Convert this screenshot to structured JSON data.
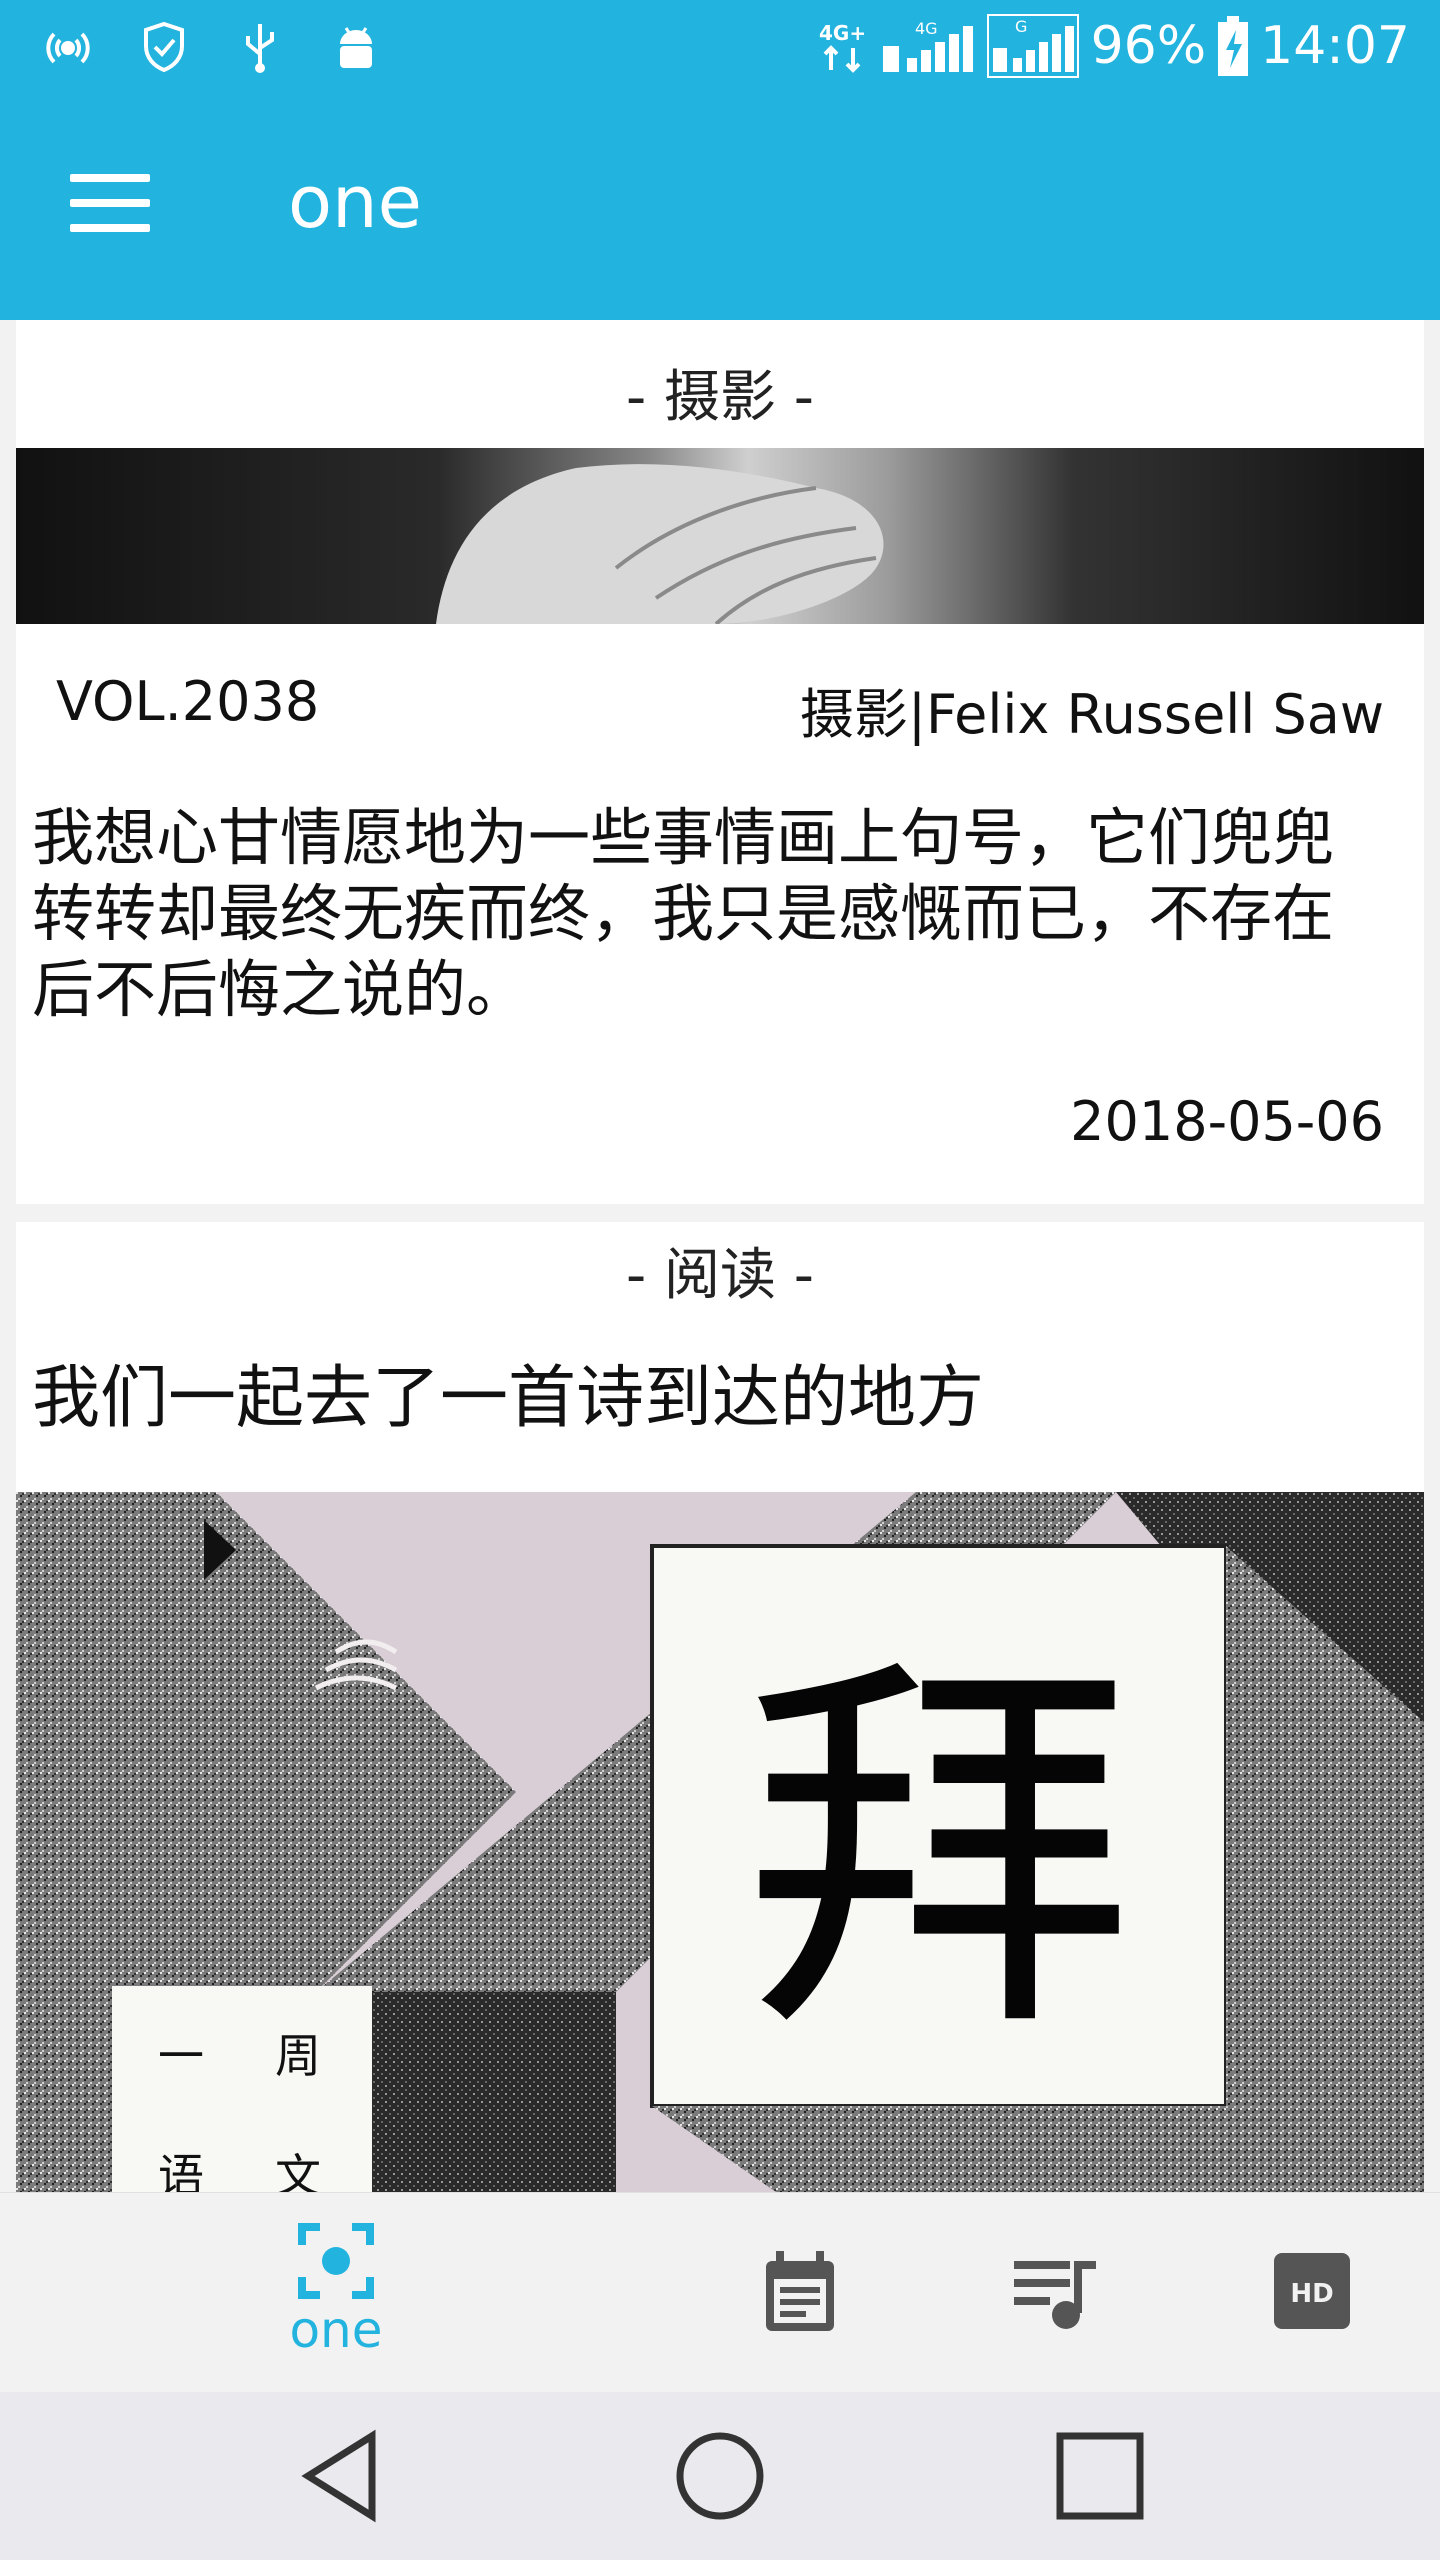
{
  "status_bar": {
    "battery": "96%",
    "time": "14:07",
    "network_4g_plus": "4G+",
    "network_4g": "4G",
    "network_g": "G"
  },
  "app_bar": {
    "title": "one",
    "menu_icon": "hamburger-menu-icon"
  },
  "photo_card": {
    "section": "- 摄影 -",
    "volume": "VOL.2038",
    "credit": "摄影|Felix Russell Saw",
    "quote": "我想心甘情愿地为一些事情画上句号，它们兜兜转转却最终无疾而终，我只是感慨而已，不存在后不后悔之说的。",
    "date": "2018-05-06"
  },
  "reading_card": {
    "section": "- 阅读 -",
    "title": "我们一起去了一首诗到达的地方",
    "art_big_char": "拜",
    "art_small_chars": [
      "一",
      "周",
      "语",
      "文"
    ]
  },
  "tabs": [
    {
      "label": "one",
      "icon": "camera-focus-icon",
      "active": true
    },
    {
      "label": "",
      "icon": "calendar-icon",
      "active": false
    },
    {
      "label": "",
      "icon": "playlist-icon",
      "active": false
    },
    {
      "label": "",
      "icon": "hd-icon",
      "active": false
    }
  ],
  "colors": {
    "primary": "#22b3de",
    "inactive_icon": "#555555"
  }
}
